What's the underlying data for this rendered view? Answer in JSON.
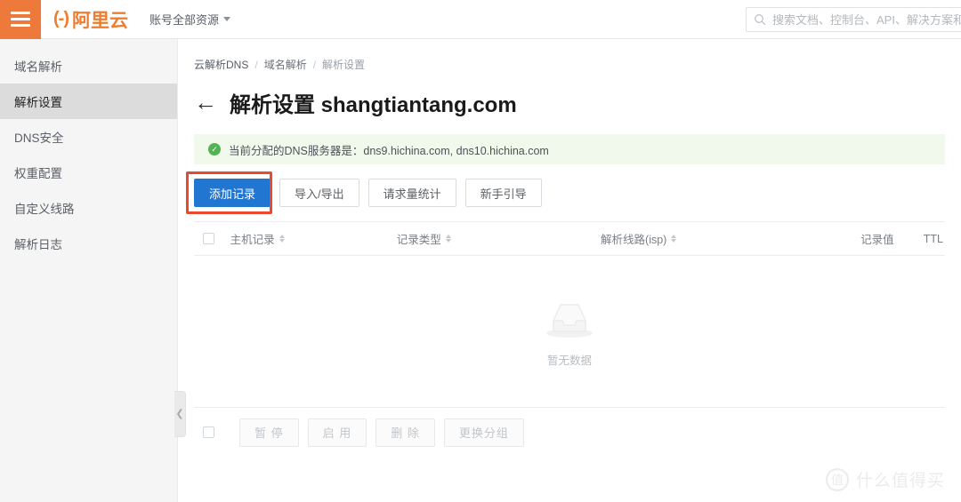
{
  "header": {
    "menu_icon": "hamburger-icon",
    "logo_mark": "(-)",
    "logo_text": "阿里云",
    "account_scope": "账号全部资源",
    "search_icon": "search-icon",
    "search_placeholder": "搜索文档、控制台、API、解决方案和资源",
    "search_value": "",
    "brand_color": "#ef7d2f",
    "menu_bg_color": "#ed7a3a"
  },
  "sidebar": {
    "items": [
      {
        "label": "域名解析",
        "active": false
      },
      {
        "label": "解析设置",
        "active": true
      },
      {
        "label": "DNS安全",
        "active": false
      },
      {
        "label": "权重配置",
        "active": false
      },
      {
        "label": "自定义线路",
        "active": false
      },
      {
        "label": "解析日志",
        "active": false
      }
    ],
    "collapse_icon": "chevron-left-icon"
  },
  "breadcrumb": {
    "items": [
      "云解析DNS",
      "域名解析",
      "解析设置"
    ],
    "separator": "/"
  },
  "page": {
    "back_icon": "arrow-left-icon",
    "title": "解析设置 shangtiantang.com"
  },
  "notice": {
    "icon": "check-circle-icon",
    "icon_glyph": "✓",
    "text": "当前分配的DNS服务器是：dns9.hichina.com, dns10.hichina.com",
    "bg_color": "#f0f9eb",
    "icon_color": "#52b352"
  },
  "toolbar": {
    "primary_label": "添加记录",
    "primary_color": "#2176d2",
    "highlight_color": "#e8492f",
    "buttons": [
      "导入/导出",
      "请求量统计",
      "新手引导"
    ]
  },
  "table": {
    "headers": {
      "host": "主机记录",
      "type": "记录类型",
      "line": "解析线路(isp)",
      "value": "记录值",
      "ttl": "TTL"
    },
    "empty": {
      "icon": "empty-inbox-icon",
      "text": "暂无数据"
    },
    "rows": []
  },
  "footbar": {
    "buttons": [
      "暂 停",
      "启 用",
      "删 除",
      "更换分组"
    ]
  },
  "watermark": {
    "mark": "值",
    "text": "什么值得买"
  }
}
